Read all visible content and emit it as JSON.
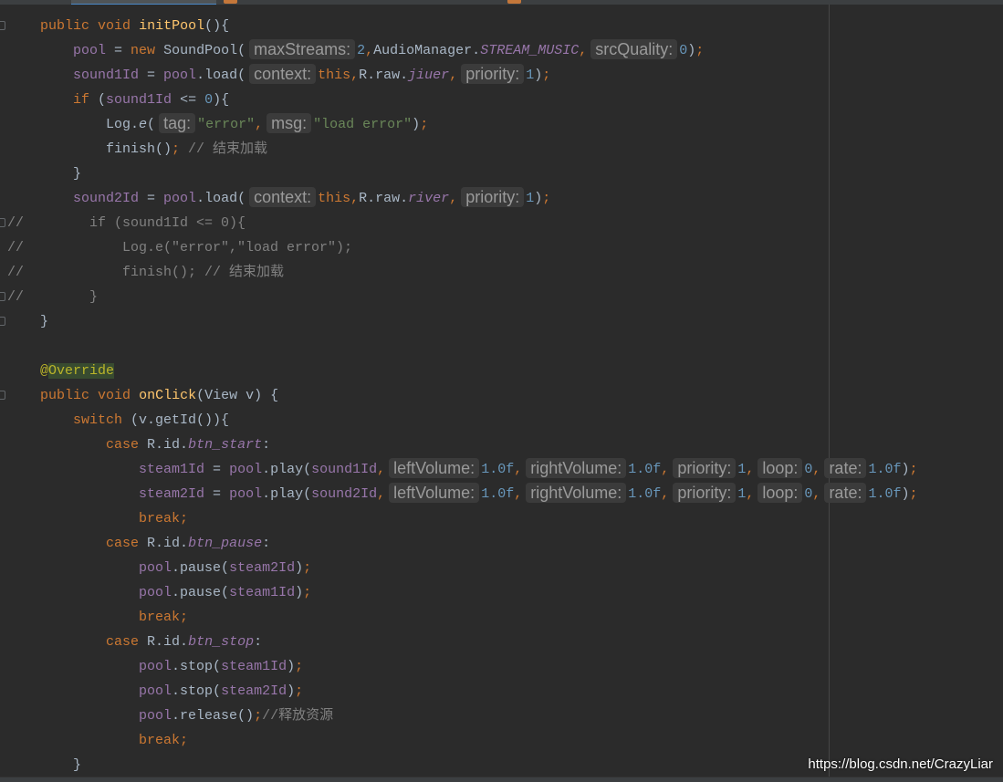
{
  "theme": {
    "background": "#2b2b2b",
    "text": "#a9b7c6",
    "keyword": "#cc7832",
    "method_declaration": "#ffc66d",
    "field": "#9876aa",
    "number": "#6897bb",
    "string": "#6a8759",
    "comment": "#808080",
    "annotation": "#bbb529",
    "annotation_highlight": "#384b30",
    "hint_text": "#9a9a9a",
    "hint_background": "#3b3b3b"
  },
  "gutter": {
    "fold_icon": "fold-icon"
  },
  "editor": {
    "lines": [
      [
        {
          "p": "    "
        },
        {
          "kw": "public void"
        },
        {
          "p": " "
        },
        {
          "fn": "initPool"
        },
        {
          "p": "(){"
        }
      ],
      [
        {
          "p": "        "
        },
        {
          "fld": "pool"
        },
        {
          "p": " = "
        },
        {
          "kw": "new"
        },
        {
          "p": " SoundPool("
        },
        {
          "hint": "maxStreams:"
        },
        {
          "num": "2"
        },
        {
          "op": ","
        },
        {
          "p": "AudioManager."
        },
        {
          "sti": "STREAM_MUSIC"
        },
        {
          "op": ","
        },
        {
          "hint": "srcQuality:"
        },
        {
          "num": "0"
        },
        {
          "p": ")"
        },
        {
          "op": ";"
        }
      ],
      [
        {
          "p": "        "
        },
        {
          "fld": "sound1Id"
        },
        {
          "p": " = "
        },
        {
          "fld": "pool"
        },
        {
          "p": ".load("
        },
        {
          "hint": "context:"
        },
        {
          "kw": "this"
        },
        {
          "op": ","
        },
        {
          "p": "R.raw."
        },
        {
          "sti": "jiuer"
        },
        {
          "op": ","
        },
        {
          "hint": "priority:"
        },
        {
          "num": "1"
        },
        {
          "p": ")"
        },
        {
          "op": ";"
        }
      ],
      [
        {
          "p": "        "
        },
        {
          "kw": "if"
        },
        {
          "p": " ("
        },
        {
          "fld": "sound1Id"
        },
        {
          "p": " <= "
        },
        {
          "num": "0"
        },
        {
          "p": "){"
        }
      ],
      [
        {
          "p": "            Log."
        },
        {
          "it": "e"
        },
        {
          "p": "("
        },
        {
          "hint": "tag:"
        },
        {
          "str": "\"error\""
        },
        {
          "op": ","
        },
        {
          "hint": "msg:"
        },
        {
          "str": "\"load error\""
        },
        {
          "p": ")"
        },
        {
          "op": ";"
        }
      ],
      [
        {
          "p": "            finish()"
        },
        {
          "op": ";"
        },
        {
          "cm": " // 结束加载"
        }
      ],
      [
        {
          "p": "        }"
        }
      ],
      [
        {
          "p": "        "
        },
        {
          "fld": "sound2Id"
        },
        {
          "p": " = "
        },
        {
          "fld": "pool"
        },
        {
          "p": ".load("
        },
        {
          "hint": "context:"
        },
        {
          "kw": "this"
        },
        {
          "op": ","
        },
        {
          "p": "R.raw."
        },
        {
          "sti": "river"
        },
        {
          "op": ","
        },
        {
          "hint": "priority:"
        },
        {
          "num": "1"
        },
        {
          "p": ")"
        },
        {
          "op": ";"
        }
      ],
      [
        {
          "cm": "//        if (sound1Id <= 0){"
        }
      ],
      [
        {
          "cm": "//            Log.e(\"error\",\"load error\");"
        }
      ],
      [
        {
          "cm": "//            finish(); // 结束加载"
        }
      ],
      [
        {
          "cm": "//        }"
        }
      ],
      [
        {
          "p": "    }"
        }
      ],
      [],
      [
        {
          "p": "    "
        },
        {
          "ann": "@"
        },
        {
          "annhl": "Override"
        }
      ],
      [
        {
          "p": "    "
        },
        {
          "kw": "public void"
        },
        {
          "p": " "
        },
        {
          "fn": "onClick"
        },
        {
          "p": "(View v) {"
        }
      ],
      [
        {
          "p": "        "
        },
        {
          "kw": "switch"
        },
        {
          "p": " (v.getId()){"
        }
      ],
      [
        {
          "p": "            "
        },
        {
          "kw": "case"
        },
        {
          "p": " R.id."
        },
        {
          "sti": "btn_start"
        },
        {
          "p": ":"
        }
      ],
      [
        {
          "p": "                "
        },
        {
          "fld": "steam1Id"
        },
        {
          "p": " = "
        },
        {
          "fld": "pool"
        },
        {
          "p": ".play("
        },
        {
          "fld": "sound1Id"
        },
        {
          "op": ","
        },
        {
          "hint": "leftVolume:"
        },
        {
          "num": "1.0f"
        },
        {
          "op": ","
        },
        {
          "hint": "rightVolume:"
        },
        {
          "num": "1.0f"
        },
        {
          "op": ","
        },
        {
          "hint": "priority:"
        },
        {
          "num": "1"
        },
        {
          "op": ","
        },
        {
          "hint": "loop:"
        },
        {
          "num": "0"
        },
        {
          "op": ","
        },
        {
          "hint": "rate:"
        },
        {
          "num": "1.0f"
        },
        {
          "p": ")"
        },
        {
          "op": ";"
        }
      ],
      [
        {
          "p": "                "
        },
        {
          "fld": "steam2Id"
        },
        {
          "p": " = "
        },
        {
          "fld": "pool"
        },
        {
          "p": ".play("
        },
        {
          "fld": "sound2Id"
        },
        {
          "op": ","
        },
        {
          "hint": "leftVolume:"
        },
        {
          "num": "1.0f"
        },
        {
          "op": ","
        },
        {
          "hint": "rightVolume:"
        },
        {
          "num": "1.0f"
        },
        {
          "op": ","
        },
        {
          "hint": "priority:"
        },
        {
          "num": "1"
        },
        {
          "op": ","
        },
        {
          "hint": "loop:"
        },
        {
          "num": "0"
        },
        {
          "op": ","
        },
        {
          "hint": "rate:"
        },
        {
          "num": "1.0f"
        },
        {
          "p": ")"
        },
        {
          "op": ";"
        }
      ],
      [
        {
          "p": "                "
        },
        {
          "kw": "break"
        },
        {
          "op": ";"
        }
      ],
      [
        {
          "p": "            "
        },
        {
          "kw": "case"
        },
        {
          "p": " R.id."
        },
        {
          "sti": "btn_pause"
        },
        {
          "p": ":"
        }
      ],
      [
        {
          "p": "                "
        },
        {
          "fld": "pool"
        },
        {
          "p": ".pause("
        },
        {
          "fld": "steam2Id"
        },
        {
          "p": ")"
        },
        {
          "op": ";"
        }
      ],
      [
        {
          "p": "                "
        },
        {
          "fld": "pool"
        },
        {
          "p": ".pause("
        },
        {
          "fld": "steam1Id"
        },
        {
          "p": ")"
        },
        {
          "op": ";"
        }
      ],
      [
        {
          "p": "                "
        },
        {
          "kw": "break"
        },
        {
          "op": ";"
        }
      ],
      [
        {
          "p": "            "
        },
        {
          "kw": "case"
        },
        {
          "p": " R.id."
        },
        {
          "sti": "btn_stop"
        },
        {
          "p": ":"
        }
      ],
      [
        {
          "p": "                "
        },
        {
          "fld": "pool"
        },
        {
          "p": ".stop("
        },
        {
          "fld": "steam1Id"
        },
        {
          "p": ")"
        },
        {
          "op": ";"
        }
      ],
      [
        {
          "p": "                "
        },
        {
          "fld": "pool"
        },
        {
          "p": ".stop("
        },
        {
          "fld": "steam2Id"
        },
        {
          "p": ")"
        },
        {
          "op": ";"
        }
      ],
      [
        {
          "p": "                "
        },
        {
          "fld": "pool"
        },
        {
          "p": ".release()"
        },
        {
          "op": ";"
        },
        {
          "cm": "//释放资源"
        }
      ],
      [
        {
          "p": "                "
        },
        {
          "kw": "break"
        },
        {
          "op": ";"
        }
      ],
      [
        {
          "p": "        }"
        }
      ]
    ]
  },
  "watermark": {
    "text": "https://blog.csdn.net/CrazyLiar"
  }
}
